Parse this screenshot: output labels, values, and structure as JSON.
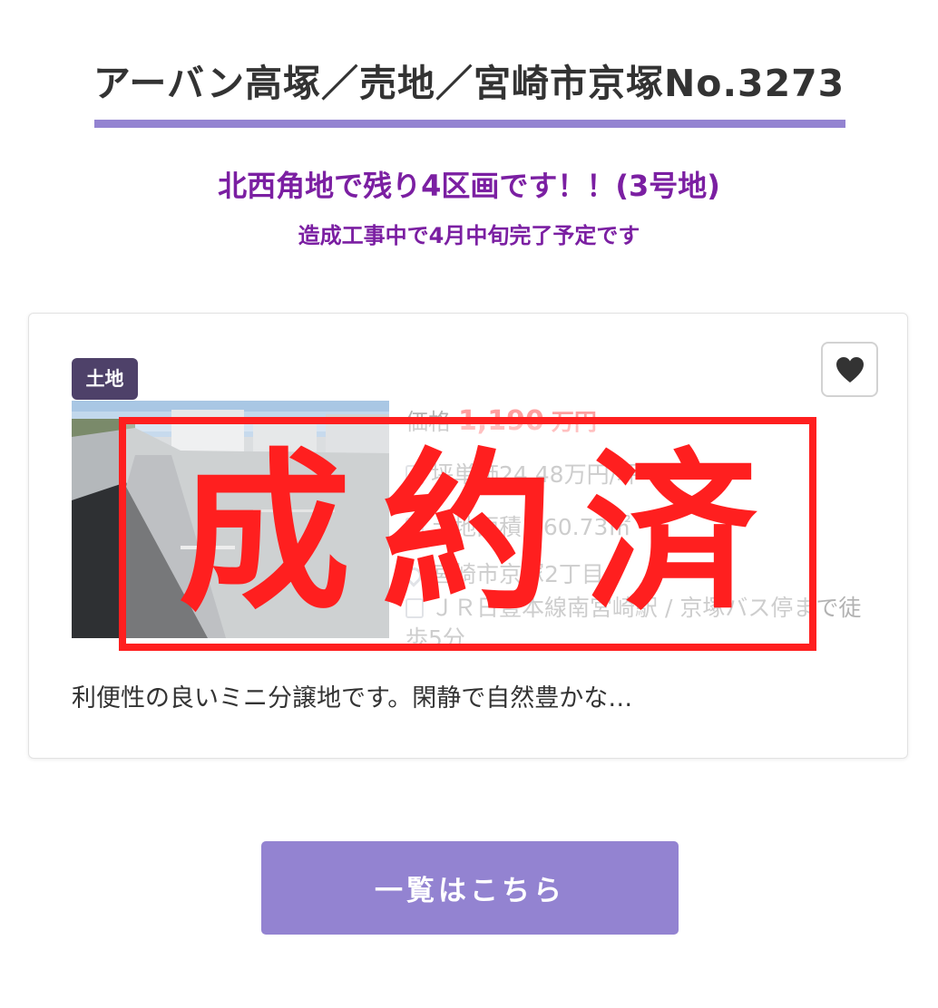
{
  "header": {
    "title": "アーバン高塚／売地／宮崎市京塚No.3273",
    "subtitle": "北西角地で残り4区画です！！(3号地)",
    "note": "造成工事中で4月中旬完了予定です"
  },
  "listing": {
    "type_badge": "土地",
    "favorite_icon": "heart-icon",
    "price_label": "価格",
    "price_value": "1,190",
    "price_unit": "万円",
    "tsubo_price": "坪単価24.48万円/坪",
    "land_area": "土地面積 160.73㎡",
    "address": "宮崎市京塚2丁目",
    "access": "ＪＲ日豊本線南宮崎駅 / 京塚バス停まで徒歩5分",
    "status_stamp": "成約済",
    "description": "利便性の良いミニ分譲地です。閑静で自然豊かな…"
  },
  "footer": {
    "list_button_label": "一覧はこちら"
  },
  "colors": {
    "accent": "#9383d1",
    "headline": "#7b1fa2",
    "stamp": "#ff1f1f",
    "badge": "#4e4169"
  }
}
